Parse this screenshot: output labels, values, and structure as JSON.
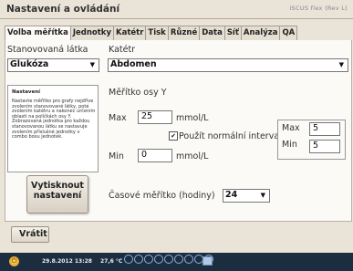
{
  "window": {
    "title": "Nastavení a ovládání",
    "brand": "ISCUS flex (Rev L)"
  },
  "tabs": [
    "Volba měřítka",
    "Jednotky",
    "Katétr",
    "Tisk",
    "Různé",
    "Data",
    "Síť",
    "Analýza",
    "QA"
  ],
  "active_tab": "Volba měřítka",
  "substance": {
    "label": "Stanovovaná látka",
    "value": "Glukóza"
  },
  "catheter": {
    "label": "Katétr",
    "value": "Abdomen"
  },
  "info": {
    "title": "Nastavení",
    "text": "Nastavte měřítko pro grafy nejdříve zvolením stanovované látky, poté zvolením katétru a nakonec určením oblasti na políčkách osy Y. Zobrazovaná jednotka pro každou stanovovanou látku se nastavuje zvolením příslušné jednotky v combo boxu jednotek."
  },
  "print_button": {
    "line1": "Vytisknout",
    "line2": "nastavení"
  },
  "yaxis": {
    "heading": "Měřítko osy Y",
    "max_label": "Max",
    "max_value": "25",
    "max_unit": "mmol/L",
    "min_label": "Min",
    "min_value": "0",
    "min_unit": "mmol/L",
    "normal_interval_label": "Použít normální interval",
    "normal_interval_checked": true,
    "normal_max_label": "Max",
    "normal_max_value": "5",
    "normal_min_label": "Min",
    "normal_min_value": "5"
  },
  "time_scale": {
    "label": "Časové měřítko (hodiny)",
    "value": "24"
  },
  "back_button": {
    "label": "Vrátit"
  },
  "status": {
    "datetime": "29.8.2012 13:28",
    "temperature": "27,6 °C"
  }
}
